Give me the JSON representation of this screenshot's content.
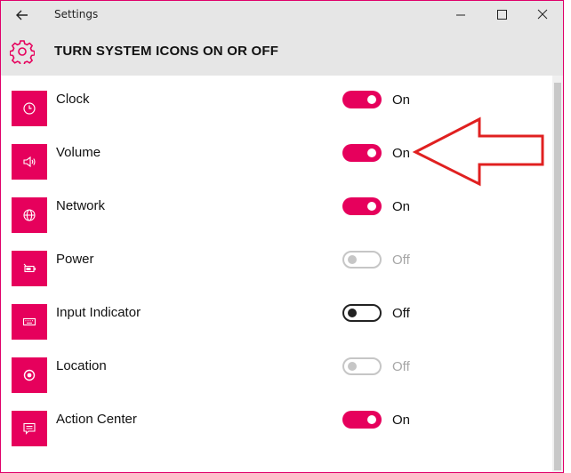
{
  "window": {
    "title": "Settings"
  },
  "header": {
    "title": "TURN SYSTEM ICONS ON OR OFF",
    "icon": "gear-icon"
  },
  "colors": {
    "accent": "#e6005c",
    "annotation_arrow": "#e02020"
  },
  "items": [
    {
      "label": "Clock",
      "state": "On",
      "status": "on",
      "icon": "clock-icon"
    },
    {
      "label": "Volume",
      "state": "On",
      "status": "on",
      "icon": "volume-icon"
    },
    {
      "label": "Network",
      "state": "On",
      "status": "on",
      "icon": "network-icon"
    },
    {
      "label": "Power",
      "state": "Off",
      "status": "disabled",
      "icon": "power-icon"
    },
    {
      "label": "Input Indicator",
      "state": "Off",
      "status": "off",
      "icon": "keyboard-icon"
    },
    {
      "label": "Location",
      "state": "Off",
      "status": "disabled",
      "icon": "location-icon"
    },
    {
      "label": "Action Center",
      "state": "On",
      "status": "on",
      "icon": "action-center-icon"
    }
  ]
}
